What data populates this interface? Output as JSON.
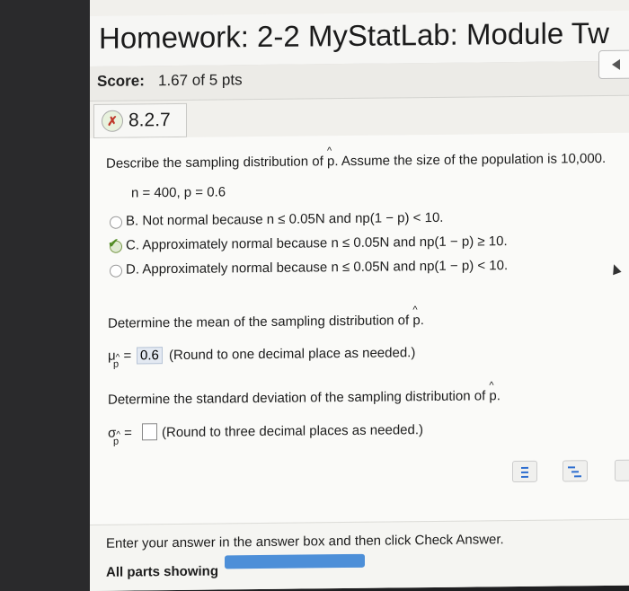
{
  "header": {
    "title": "Homework: 2-2 MyStatLab: Module Tw"
  },
  "score": {
    "label": "Score:",
    "value": "1.67 of 5 pts"
  },
  "question": {
    "id": "8.2.7",
    "status_icon": "partial-credit-icon"
  },
  "prompt": {
    "describe_pre": "Describe the sampling distribution of",
    "p": "p",
    "describe_post": ". Assume the size of the population is 10,000.",
    "given": "n = 400, p = 0.6"
  },
  "options": [
    {
      "letter": "B.",
      "text": "Not normal because n ≤ 0.05N and np(1 − p) < 10."
    },
    {
      "letter": "C.",
      "text": "Approximately normal because n ≤ 0.05N and np(1 − p) ≥ 10."
    },
    {
      "letter": "D.",
      "text": "Approximately normal because n ≤ 0.05N and np(1 − p) < 10."
    }
  ],
  "mean": {
    "prompt": "Determine the mean of the sampling distribution of",
    "p": "p",
    "symbol": "μ",
    "sub": "p",
    "eq": "=",
    "value": "0.6",
    "hint": "(Round to one decimal place as needed.)"
  },
  "sd": {
    "prompt": "Determine the standard deviation of the sampling distribution of",
    "p": "p",
    "symbol": "σ",
    "sub": "p",
    "eq": "=",
    "hint": "(Round to three decimal places as needed.)"
  },
  "footer": {
    "instruction": "Enter your answer in the answer box and then click Check Answer.",
    "parts_label": "All parts showing"
  }
}
